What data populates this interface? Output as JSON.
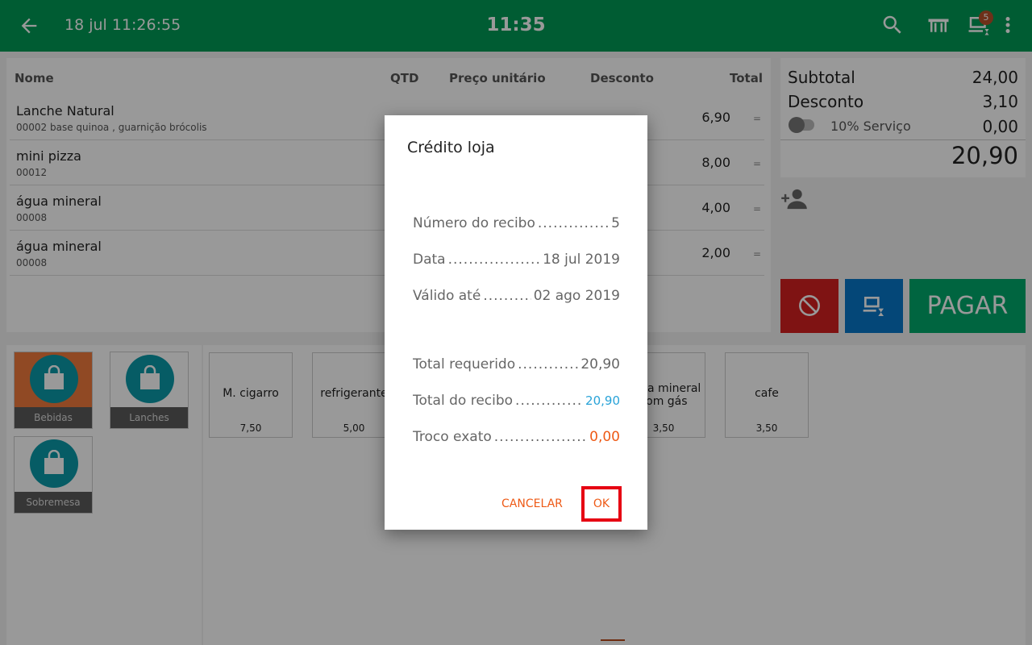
{
  "header": {
    "datetime": "18 jul 11:26:55",
    "clock": "11:35",
    "notification_count": "5"
  },
  "order": {
    "columns": {
      "name": "Nome",
      "qty": "QTD",
      "unit_price": "Preço unitário",
      "discount": "Desconto",
      "total": "Total"
    },
    "items": [
      {
        "name": "Lanche Natural",
        "detail": "00002  base quinoa , guarnição brócolis",
        "total": "6,90"
      },
      {
        "name": "mini pizza",
        "detail": "00012",
        "total": "8,00"
      },
      {
        "name": "água mineral",
        "detail": "00008",
        "total": "4,00"
      },
      {
        "name": "água mineral",
        "detail": "00008",
        "total": "2,00"
      }
    ],
    "more_glyph": "="
  },
  "summary": {
    "subtotal_label": "Subtotal",
    "subtotal_value": "24,00",
    "discount_label": "Desconto",
    "discount_value": "3,10",
    "service_label": "10% Serviço",
    "service_value": "0,00",
    "grand_total": "20,90"
  },
  "actions": {
    "pay_label": "PAGAR"
  },
  "categories": [
    {
      "label": "Bebidas",
      "color": "#f07a3c"
    },
    {
      "label": "Lanches",
      "color": "#ffffff"
    },
    {
      "label": "Sobremesa",
      "color": "#ffffff"
    }
  ],
  "products": [
    {
      "name": "M. cigarro",
      "price": "7,50"
    },
    {
      "name": "refrigerante",
      "price": "5,00"
    },
    {
      "name": "água mineral com gás",
      "price": "3,50"
    },
    {
      "name": "cafe",
      "price": "3,50"
    }
  ],
  "dialog": {
    "title": "Crédito loja",
    "receipt_number_label": "Número do recibo",
    "receipt_number_value": "5",
    "date_label": "Data",
    "date_value": "18 jul 2019",
    "valid_until_label": "Válido até",
    "valid_until_value": "02 ago 2019",
    "total_required_label": "Total requerido",
    "total_required_value": "20,90",
    "receipt_total_label": "Total do recibo",
    "receipt_total_value": "20,90",
    "exact_change_label": "Troco exato",
    "exact_change_value": "0,00",
    "cancel_label": "CANCELAR",
    "ok_label": "OK"
  },
  "colors": {
    "topbar": "#009955",
    "pay": "#00a86b",
    "cancel_action": "#d42020",
    "wait_action": "#0877c9",
    "accent": "#ee5a16",
    "highlight_box": "#e60012"
  }
}
